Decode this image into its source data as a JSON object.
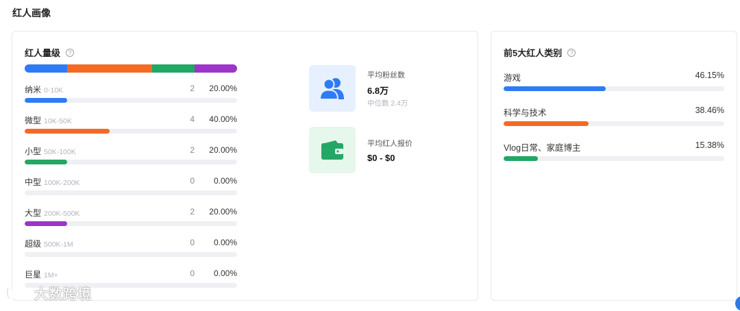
{
  "page": {
    "title": "红人画像"
  },
  "tiers_card": {
    "title": "红人量级",
    "help_icon": "question-circle-icon",
    "segments": [
      {
        "color": "#2f7bf5",
        "share": 0.2
      },
      {
        "color": "#f46a25",
        "share": 0.4
      },
      {
        "color": "#23a765",
        "share": 0.2
      },
      {
        "color": "#9b36c8",
        "share": 0.2
      }
    ],
    "tiers": [
      {
        "name": "纳米",
        "range": "0-10K",
        "count": "2",
        "pct": "20.00%",
        "fill": 0.2,
        "color": "#2f7bf5"
      },
      {
        "name": "微型",
        "range": "10K-50K",
        "count": "4",
        "pct": "40.00%",
        "fill": 0.4,
        "color": "#f46a25"
      },
      {
        "name": "小型",
        "range": "50K-100K",
        "count": "2",
        "pct": "20.00%",
        "fill": 0.2,
        "color": "#23a765"
      },
      {
        "name": "中型",
        "range": "100K-200K",
        "count": "0",
        "pct": "0.00%",
        "fill": 0,
        "color": "#9b36c8"
      },
      {
        "name": "大型",
        "range": "200K-500K",
        "count": "2",
        "pct": "20.00%",
        "fill": 0.2,
        "color": "#9b36c8"
      },
      {
        "name": "超级",
        "range": "500K-1M",
        "count": "0",
        "pct": "0.00%",
        "fill": 0,
        "color": "#2f7bf5"
      },
      {
        "name": "巨星",
        "range": "1M+",
        "count": "0",
        "pct": "0.00%",
        "fill": 0,
        "color": "#2f7bf5"
      }
    ],
    "avg_followers": {
      "icon": "users-icon",
      "label": "平均粉丝数",
      "value": "6.8万",
      "sub": "中位数 2.4万"
    },
    "avg_price": {
      "icon": "wallet-icon",
      "label": "平均红人报价",
      "value": "$0 - $0"
    }
  },
  "categories_card": {
    "title": "前5大红人类别",
    "help_icon": "question-circle-icon",
    "items": [
      {
        "name": "游戏",
        "pct": "46.15%",
        "fill": 0.4615,
        "color": "#2f7bf5"
      },
      {
        "name": "科学与技术",
        "pct": "38.46%",
        "fill": 0.3846,
        "color": "#f46a25"
      },
      {
        "name": "Vlog日常、家庭博主",
        "pct": "15.38%",
        "fill": 0.1538,
        "color": "#23a765"
      }
    ]
  },
  "watermark": {
    "text": "大数跨境",
    "logo": "brand-logo-icon"
  }
}
